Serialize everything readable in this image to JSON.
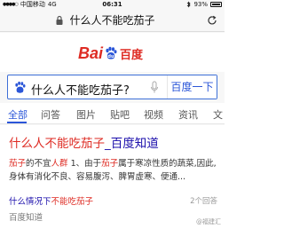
{
  "status_bar": {
    "carrier": "中国移动",
    "network": "4G",
    "time": "06:31",
    "battery": "93%"
  },
  "url_bar": {
    "query": "什么人不能吃茄子"
  },
  "logo": {
    "bai": "Bai",
    "du": "du",
    "cn": "百度"
  },
  "search": {
    "query": "什么人不能吃茄子?",
    "button": "百度一下"
  },
  "tabs": [
    "全部",
    "问答",
    "图片",
    "贴吧",
    "视频",
    "资讯",
    "文"
  ],
  "result": {
    "title_hl": "什么人不能吃茄子",
    "title_rest": "_百度知道",
    "snippet_hl1": "茄子",
    "snippet_p1": "的不宜",
    "snippet_hl2": "人群",
    "snippet_p2": " 1、由于",
    "snippet_hl3": "茄子",
    "snippet_p3": "属于寒凉性质的蔬菜,因此,身体有消化不良、容易腹泻、脾胃虚寒、便通...",
    "related_pre": "什么情况下",
    "related_hl": "不能吃茄子",
    "source": "百度知道",
    "count": "2个回答",
    "watermark": "@福建汇"
  }
}
